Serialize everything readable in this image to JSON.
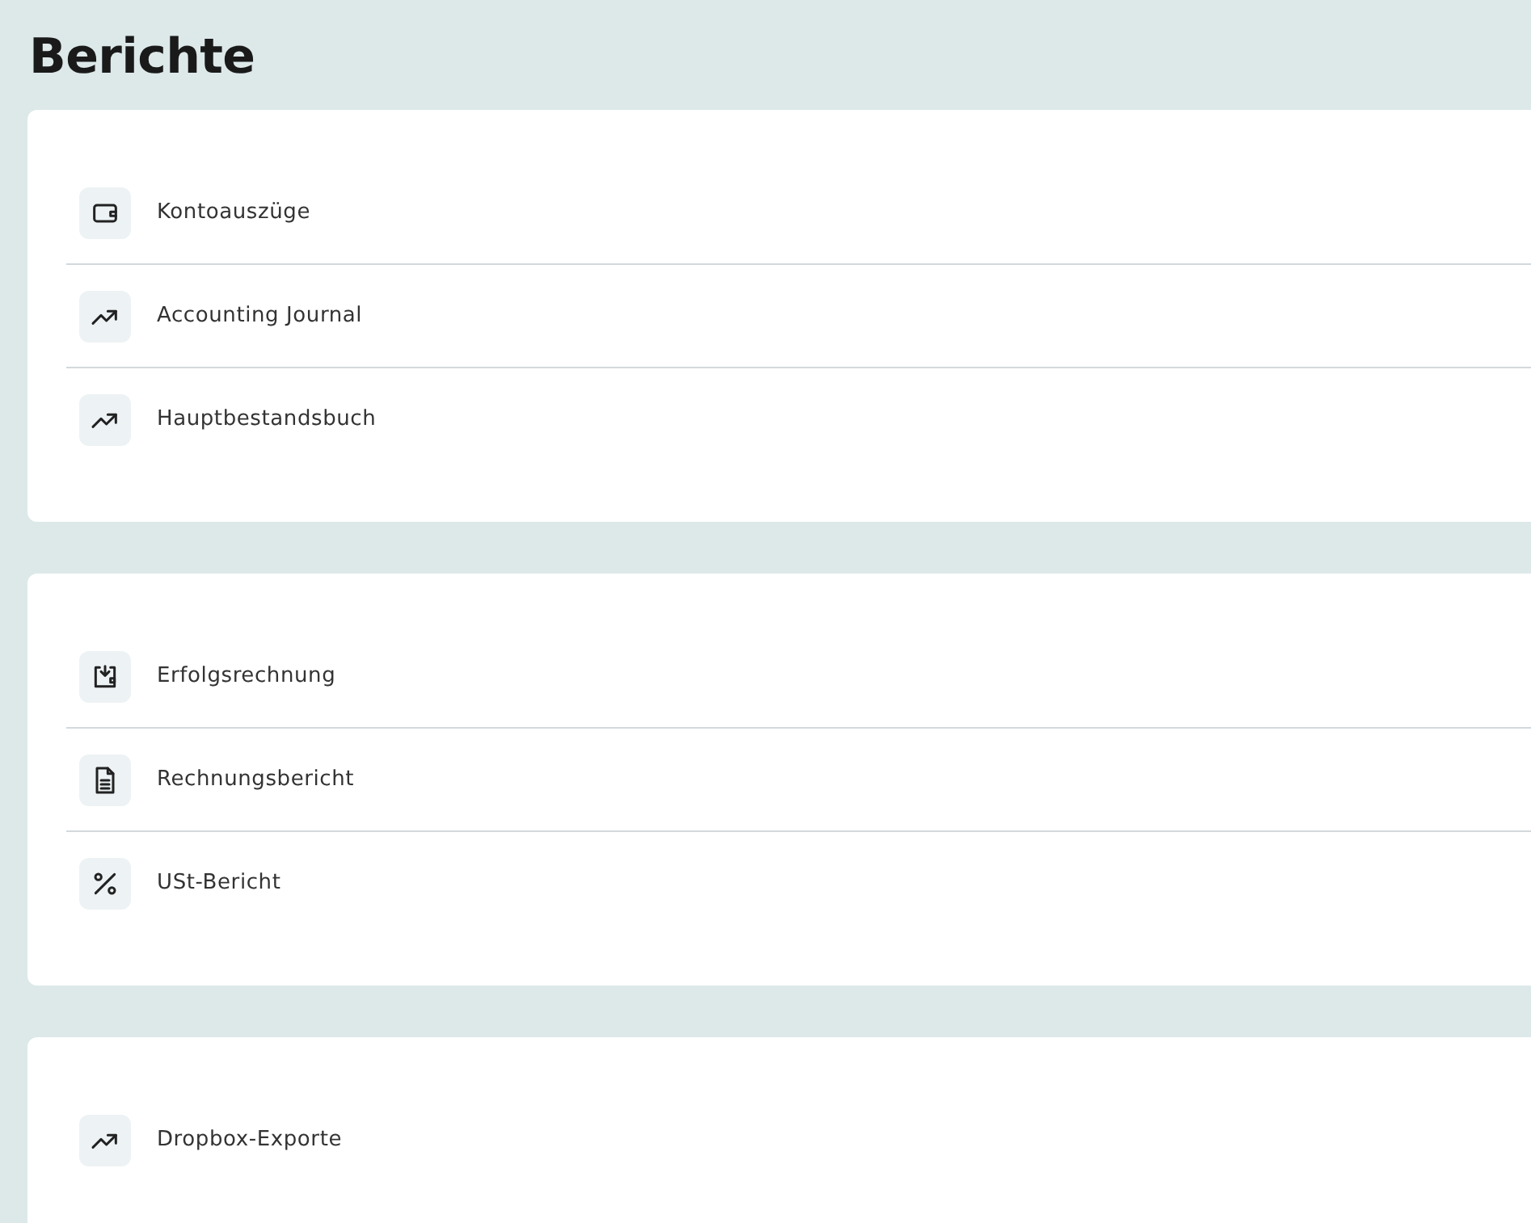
{
  "page": {
    "title": "Berichte"
  },
  "sections": [
    {
      "items": [
        {
          "label": "Kontoauszüge",
          "kind": "wallet"
        },
        {
          "label": "Accounting Journal",
          "kind": "trend"
        },
        {
          "label": "Hauptbestandsbuch",
          "kind": "trend"
        }
      ]
    },
    {
      "items": [
        {
          "label": "Erfolgsrechnung",
          "kind": "inbox"
        },
        {
          "label": "Rechnungsbericht",
          "kind": "document"
        },
        {
          "label": "USt-Bericht",
          "kind": "percent"
        }
      ]
    },
    {
      "items": [
        {
          "label": "Dropbox-Exporte",
          "kind": "trend"
        }
      ]
    }
  ]
}
